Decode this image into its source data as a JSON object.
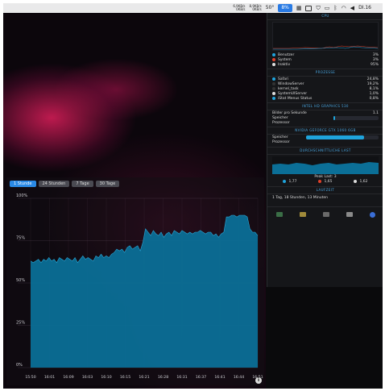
{
  "menubar": {
    "net_up": "6,9KB/s",
    "net_down": "0KB/s",
    "net2_up": "8,9KB/s",
    "net2_down": "0KB/s",
    "temp": "50°",
    "cpu_label": "8%",
    "clock": "DI.16"
  },
  "panel": {
    "cpu_title": "CPU",
    "cpu_rows": [
      {
        "label": "Benutzer",
        "value": "3%",
        "color": "#1fa4dc"
      },
      {
        "label": "System",
        "value": "3%",
        "color": "#e0402a"
      },
      {
        "label": "Inaktiv",
        "value": "95%",
        "color": "#dddddd"
      }
    ],
    "proc_title": "PROZESSE",
    "proc_rows": [
      {
        "label": "Safari",
        "value": "24,8%",
        "color": "#1fa4dc"
      },
      {
        "label": "WindowServer",
        "value": "19,2%",
        "color": "#333333"
      },
      {
        "label": "kernel_task",
        "value": "8,1%",
        "color": "#333333"
      },
      {
        "label": "SystemUIServer",
        "value": "1,0%",
        "color": "#dddddd"
      },
      {
        "label": "iStat Menus Status",
        "value": "0,8%",
        "color": "#1fa4dc"
      }
    ],
    "gfx_title": "INTEL HD GRAPHICS 530",
    "gfx_fps_label": "Bilder pro Sekunde",
    "gfx_fps_value": "1.1",
    "gfx_mem_label": "Speicher",
    "gfx_proc_label": "Prozessor",
    "gfx_mem_level": 0.03,
    "nv_title": "NVIDIA GEFORCE GTX 1060 6GB",
    "nv_mem_label": "Speicher",
    "nv_mem_level": 0.8,
    "nv_proc_label": "Prozessor",
    "load_title": "DURCHSCHNITTLICHE LAST",
    "peak_label": "Peak Last: 3",
    "load_values": [
      {
        "label": "1,77",
        "color": "#1fa4dc"
      },
      {
        "label": "1,65",
        "color": "#e0402a"
      },
      {
        "label": "1,62",
        "color": "#dddddd"
      }
    ],
    "uptime_title": "LAUFZEIT",
    "uptime_value": "1 Tag, 18 Stunden, 13 Minuten",
    "footer_icons": [
      {
        "name": "activity-monitor-icon",
        "color": "#3a6e46"
      },
      {
        "name": "folder-icon",
        "color": "#a08a3a"
      },
      {
        "name": "console-icon",
        "color": "#6a6a6a"
      },
      {
        "name": "sync-icon",
        "color": "#8a8a8a"
      },
      {
        "name": "globe-icon",
        "color": "#3a6ed6"
      }
    ]
  },
  "chart": {
    "tabs": [
      "1 Stunde",
      "24 Stunden",
      "7 Tage",
      "30 Tage"
    ],
    "active_tab": 0,
    "info_label": "i"
  },
  "chart_data": {
    "type": "area",
    "title": "",
    "xlabel": "",
    "ylabel": "",
    "ylim": [
      0,
      100
    ],
    "y_ticks": [
      "0%",
      "25%",
      "50%",
      "75%",
      "100%"
    ],
    "x_ticks": [
      "15:50",
      "16:01",
      "16:09",
      "16:03",
      "16:10",
      "16:15",
      "16:21",
      "16:28",
      "16:31",
      "16:37",
      "16:41",
      "16:44",
      "16:51"
    ],
    "color": "#0b6f97",
    "grid": true,
    "series": [
      {
        "values": [
          63,
          62,
          63,
          64,
          62,
          64,
          63,
          65,
          63,
          64,
          62,
          65,
          64,
          63,
          65,
          64,
          63,
          65,
          62,
          64,
          66,
          64,
          65,
          64,
          63,
          66,
          65,
          67,
          65,
          66,
          65,
          67,
          68,
          70,
          69,
          70,
          68,
          71,
          72,
          70,
          71,
          72,
          69,
          74,
          82,
          80,
          78,
          81,
          79,
          78,
          80,
          77,
          79,
          80,
          78,
          81,
          80,
          79,
          81,
          80,
          79,
          80,
          79,
          80,
          80,
          81,
          80,
          79,
          80,
          80,
          78,
          79,
          77,
          79,
          80,
          89,
          89,
          90,
          90,
          89,
          90,
          90,
          90,
          89,
          82,
          80,
          80,
          78
        ]
      }
    ]
  }
}
